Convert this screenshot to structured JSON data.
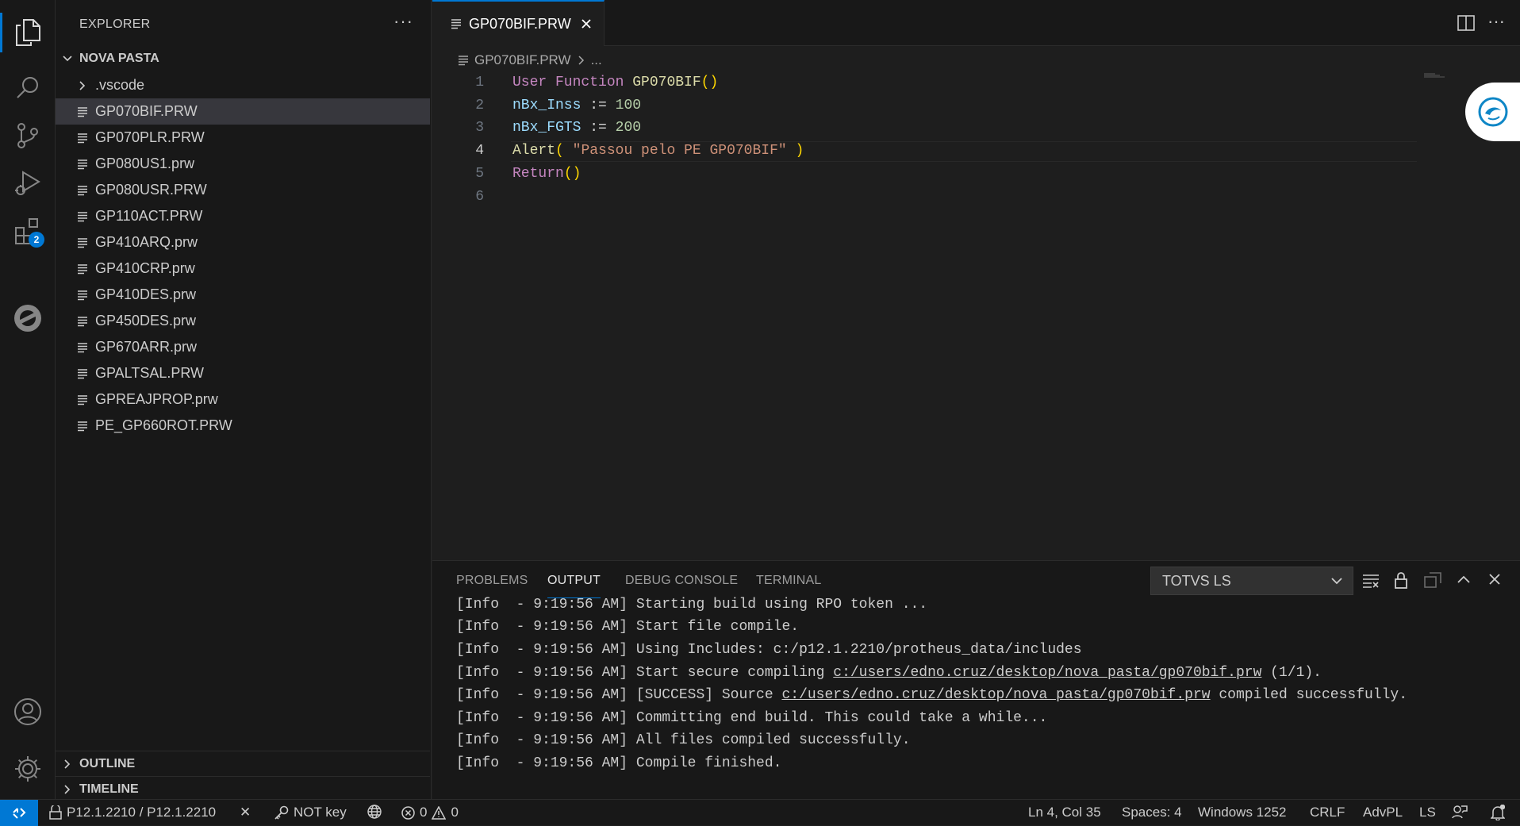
{
  "sidebar": {
    "title": "EXPLORER",
    "more": "···",
    "folder": "NOVA PASTA",
    "subfolder": ".vscode",
    "files": [
      "GP070BIF.PRW",
      "GP070PLR.PRW",
      "GP080US1.prw",
      "GP080USR.PRW",
      "GP110ACT.PRW",
      "GP410ARQ.prw",
      "GP410CRP.prw",
      "GP410DES.prw",
      "GP450DES.prw",
      "GP670ARR.prw",
      "GPALTSAL.PRW",
      "GPREAJPROP.prw",
      "PE_GP660ROT.PRW"
    ],
    "selected_file": "GP070BIF.PRW",
    "outline": "OUTLINE",
    "timeline": "TIMELINE"
  },
  "activity": {
    "extensions_badge": "2"
  },
  "editor": {
    "tab": "GP070BIF.PRW",
    "breadcrumb_file": "GP070BIF.PRW",
    "breadcrumb_more": "...",
    "line_numbers": [
      "1",
      "2",
      "3",
      "4",
      "5",
      "6"
    ],
    "code": {
      "l1_kw": "User Function",
      "l1_name": "GP070BIF",
      "l1_paren": "()",
      "l2_var": "nBx_Inss",
      "l2_op": ":=",
      "l2_num": "100",
      "l3_var": "nBx_FGTS",
      "l3_op": ":=",
      "l3_num": "200",
      "l4_fn": "Alert",
      "l4_open": "(",
      "l4_str": "\"Passou pelo PE GP070BIF\"",
      "l4_close": ")",
      "l5_kw": "Return",
      "l5_paren": "()"
    }
  },
  "panel": {
    "tabs": [
      "PROBLEMS",
      "OUTPUT",
      "DEBUG CONSOLE",
      "TERMINAL"
    ],
    "active_tab": "OUTPUT",
    "channel": "TOTVS LS",
    "lines": [
      {
        "pre": "[Info  - 9:19:56 AM] Starting build using RPO token ...",
        "link": "",
        "post": ""
      },
      {
        "pre": "[Info  - 9:19:56 AM] Start file compile.",
        "link": "",
        "post": ""
      },
      {
        "pre": "[Info  - 9:19:56 AM] Using Includes: c:/p12.1.2210/protheus_data/includes",
        "link": "",
        "post": ""
      },
      {
        "pre": "[Info  - 9:19:56 AM] Start secure compiling ",
        "link": "c:/users/edno.cruz/desktop/nova pasta/gp070bif.prw",
        "post": " (1/1)."
      },
      {
        "pre": "[Info  - 9:19:56 AM] [SUCCESS] Source ",
        "link": "c:/users/edno.cruz/desktop/nova pasta/gp070bif.prw",
        "post": " compiled successfully."
      },
      {
        "pre": "[Info  - 9:19:56 AM] Committing end build. This could take a while...",
        "link": "",
        "post": ""
      },
      {
        "pre": "[Info  - 9:19:56 AM] All files compiled successfully.",
        "link": "",
        "post": ""
      },
      {
        "pre": "[Info  - 9:19:56 AM] Compile finished.",
        "link": "",
        "post": ""
      }
    ]
  },
  "status": {
    "environment": "P12.1.2210 / P12.1.2210",
    "close": "✕",
    "key": "NOT key",
    "errors": "0",
    "warnings": "0",
    "position": "Ln 4, Col 35",
    "spaces": "Spaces: 4",
    "encoding": "Windows 1252",
    "eol": "CRLF",
    "language": "AdvPL",
    "ls": "LS"
  },
  "colors": {
    "accent": "#0078d4",
    "keyword": "#c586c0",
    "function": "#dcdcaa",
    "variable": "#9cdcfe",
    "number": "#b5cea8",
    "string": "#ce9178",
    "bracket": "#ffd700"
  }
}
